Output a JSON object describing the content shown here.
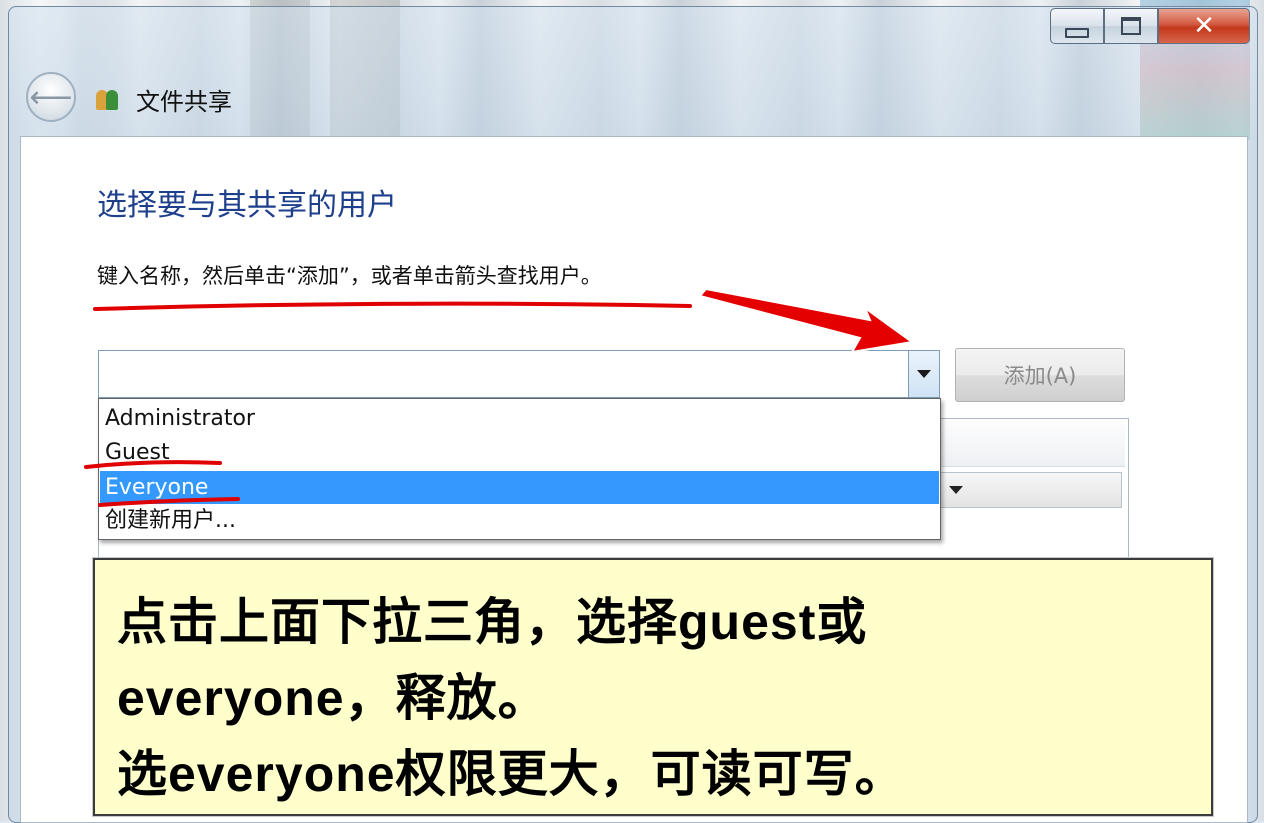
{
  "window": {
    "title": "文件共享",
    "close_glyph": "✕",
    "back_glyph": "⟵"
  },
  "page": {
    "heading": "选择要与其共享的用户",
    "instruction": "键入名称，然后单击“添加”，或者单击箭头查找用户。"
  },
  "combo": {
    "value": "",
    "add_button": "添加(A)"
  },
  "dropdown": {
    "items": [
      "Administrator",
      "Guest",
      "Everyone",
      "创建新用户..."
    ],
    "selected_index": 2
  },
  "colors": {
    "heading": "#1e3f8c",
    "selection": "#3399ff",
    "callout_bg": "#ffffcc",
    "annotation_red": "#e00000",
    "close_button": "#c3381c"
  },
  "callout": {
    "line1": "点击上面下拉三角，选择guest或",
    "line2": "everyone，释放。",
    "line3": "选everyone权限更大，可读可写。"
  }
}
